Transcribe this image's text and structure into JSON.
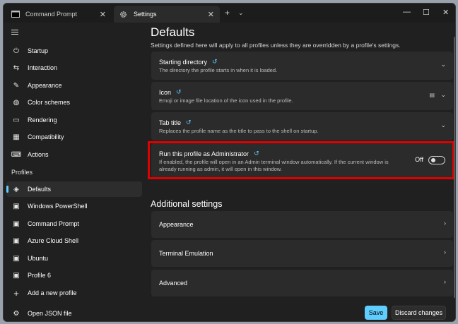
{
  "tabs": [
    {
      "label": "Command Prompt"
    },
    {
      "label": "Settings"
    }
  ],
  "window_controls": {
    "minimize": "—",
    "maximize": "☐",
    "close": "✕"
  },
  "sidebar": {
    "items": [
      {
        "label": "Startup",
        "icon": "power-icon"
      },
      {
        "label": "Interaction",
        "icon": "interaction-icon"
      },
      {
        "label": "Appearance",
        "icon": "brush-icon"
      },
      {
        "label": "Color schemes",
        "icon": "palette-icon"
      },
      {
        "label": "Rendering",
        "icon": "monitor-icon"
      },
      {
        "label": "Compatibility",
        "icon": "compat-icon"
      },
      {
        "label": "Actions",
        "icon": "keyboard-icon"
      }
    ],
    "profiles_label": "Profiles",
    "profiles": [
      {
        "label": "Defaults",
        "icon": "layers-icon"
      },
      {
        "label": "Windows PowerShell",
        "icon": "terminal-icon"
      },
      {
        "label": "Command Prompt",
        "icon": "terminal-icon"
      },
      {
        "label": "Azure Cloud Shell",
        "icon": "terminal-icon"
      },
      {
        "label": "Ubuntu",
        "icon": "terminal-icon"
      },
      {
        "label": "Profile 6",
        "icon": "terminal-icon"
      }
    ],
    "add_profile": "Add a new profile",
    "open_json": "Open JSON file"
  },
  "main": {
    "title": "Defaults",
    "description": "Settings defined here will apply to all profiles unless they are overridden by a profile's settings.",
    "cards": [
      {
        "title": "Starting directory",
        "desc": "The directory the profile starts in when it is loaded."
      },
      {
        "title": "Icon",
        "desc": "Emoji or image file location of the icon used in the profile."
      },
      {
        "title": "Tab title",
        "desc": "Replaces the profile name as the title to pass to the shell on startup."
      },
      {
        "title": "Run this profile as Administrator",
        "desc_line1": "If enabled, the profile will open in an Admin terminal window automatically. If the current window is",
        "desc_line2": "already running as admin, it will open in this window.",
        "toggle_state": "Off"
      }
    ],
    "additional_title": "Additional settings",
    "additional": [
      {
        "label": "Appearance"
      },
      {
        "label": "Terminal Emulation"
      },
      {
        "label": "Advanced"
      }
    ],
    "save_label": "Save",
    "discard_label": "Discard changes"
  },
  "colors": {
    "accent": "#60cdff",
    "highlight": "#e00000",
    "background": "#202020",
    "card": "#2b2b2b"
  }
}
